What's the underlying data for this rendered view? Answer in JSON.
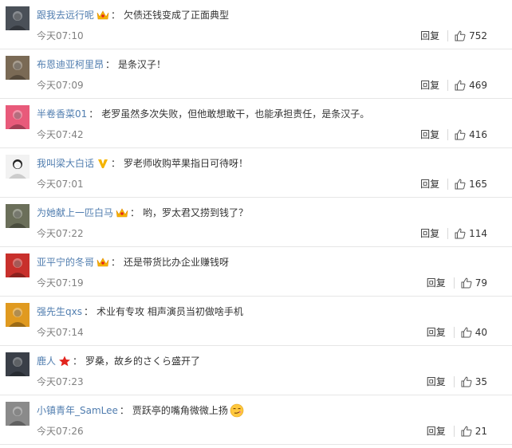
{
  "comments": [
    {
      "user": "跟我去远行呢",
      "badge": "vip-crown",
      "colon": "：",
      "text": "欠债还钱变成了正面典型",
      "time": "今天07:10",
      "reply": "回复",
      "likes": "752",
      "avatar_color": "#4a5058"
    },
    {
      "user": "布恩迪亚柯里昂",
      "badge": "",
      "colon": "：",
      "text": "是条汉子！",
      "time": "今天07:09",
      "reply": "回复",
      "likes": "469",
      "avatar_color": "#7a6a55"
    },
    {
      "user": "半卷香菜01",
      "badge": "",
      "colon": "：",
      "text": "老罗虽然多次失败，但他敢想敢干，也能承担责任，是条汉子。",
      "time": "今天07:42",
      "reply": "回复",
      "likes": "416",
      "avatar_color": "#e85a7a"
    },
    {
      "user": "我叫梁大白话",
      "badge": "v-yellow",
      "colon": "：",
      "text": "罗老师收购苹果指日可待呀！",
      "time": "今天07:01",
      "reply": "回复",
      "likes": "165",
      "avatar_color": "#f2f2f2"
    },
    {
      "user": "为她献上一匹白马",
      "badge": "vip-crown",
      "colon": "：",
      "text": "哟，罗太君又捞到钱了？",
      "time": "今天07:22",
      "reply": "回复",
      "likes": "114",
      "avatar_color": "#6b6f5a"
    },
    {
      "user": "亚平宁的冬哥",
      "badge": "vip-crown",
      "colon": "：",
      "text": "还是带货比办企业赚钱呀",
      "time": "今天07:19",
      "reply": "回复",
      "likes": "79",
      "avatar_color": "#c8302c"
    },
    {
      "user": "强先生qxs",
      "badge": "",
      "colon": "：",
      "text": "术业有专攻 相声演员当初做啥手机",
      "time": "今天07:14",
      "reply": "回复",
      "likes": "40",
      "avatar_color": "#e09a20"
    },
    {
      "user": "鹿人",
      "badge": "star-red",
      "colon": "：",
      "text": "罗桑，故乡的さくら盛开了",
      "time": "今天07:23",
      "reply": "回复",
      "likes": "35",
      "avatar_color": "#3a3f48"
    },
    {
      "user": "小镇青年_SamLee",
      "badge": "",
      "colon": "：",
      "text": "贾跃亭的嘴角微微上扬",
      "time": "今天07:26",
      "reply": "回复",
      "likes": "21",
      "avatar_color": "#8a8a8a",
      "emoji": "smirk-emoji"
    }
  ],
  "colors": {
    "username": "#507daf",
    "text": "#333333",
    "time": "#808080",
    "divider": "#e6e6e6",
    "badge_gold": "#f5b400",
    "badge_red": "#e2241e"
  }
}
